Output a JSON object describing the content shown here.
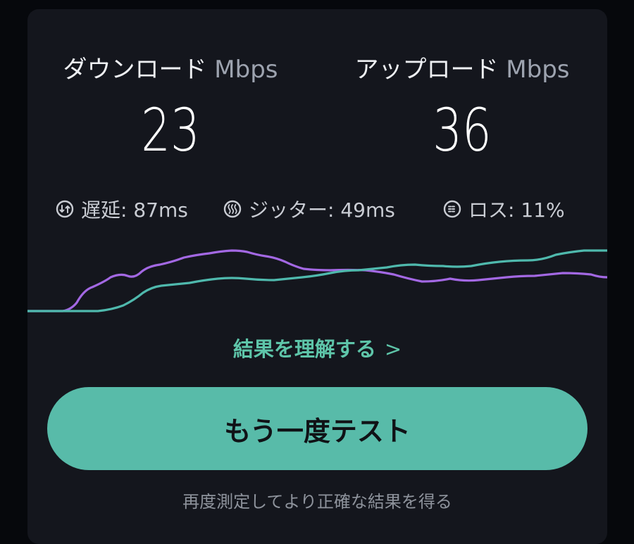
{
  "download": {
    "label": "ダウンロード",
    "unit": "Mbps",
    "value": "23"
  },
  "upload": {
    "label": "アップロード",
    "unit": "Mbps",
    "value": "36"
  },
  "stats": {
    "latency_text": "遅延: 87ms",
    "jitter_text": "ジッター: 49ms",
    "loss_text": "ロス: 11%"
  },
  "colors": {
    "download_line": "#a368e3",
    "upload_line": "#4fb9ad",
    "accent": "#58bba9"
  },
  "understand_link": {
    "label": "結果を理解する",
    "chevron": ">"
  },
  "retest_button": {
    "label": "もう一度テスト"
  },
  "hint": {
    "text": "再度測定してより正確な結果を得る"
  }
}
